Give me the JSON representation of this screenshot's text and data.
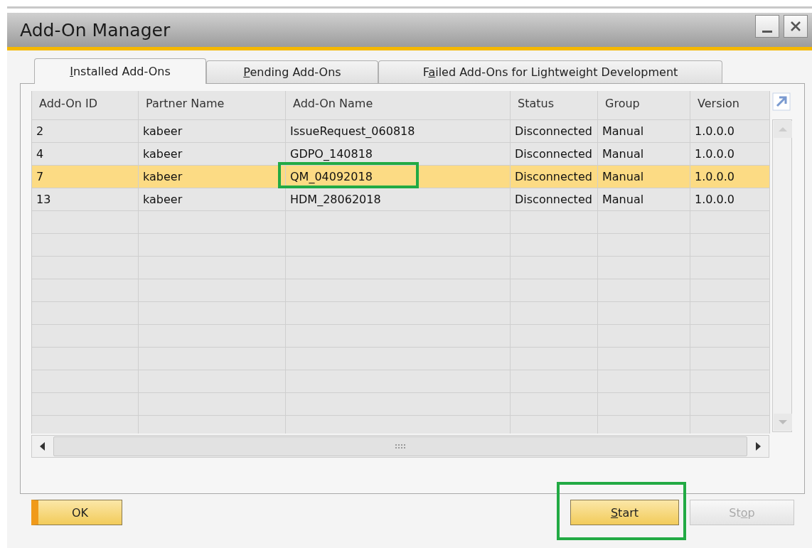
{
  "window": {
    "title": "Add-On Manager"
  },
  "tabs": [
    {
      "access_key": "I",
      "label_rest": "nstalled Add-Ons",
      "selected": true
    },
    {
      "access_key": "P",
      "label_rest": "ending Add-Ons",
      "selected": false
    },
    {
      "label_start": "F",
      "access_key": "a",
      "label_rest": "iled Add-Ons for Lightweight Development",
      "selected": false
    }
  ],
  "table": {
    "columns": [
      "Add-On ID",
      "Partner Name",
      "Add-On Name",
      "Status",
      "Group",
      "Version"
    ],
    "rows": [
      {
        "selected": false,
        "cells": [
          {
            "text": "2",
            "marked": false
          },
          {
            "text": "kabeer",
            "marked": false
          },
          {
            "text": "IssueRequest_060818",
            "marked": false
          },
          {
            "text": "Disconnected",
            "marked": false
          },
          {
            "text": "Manual",
            "marked": false
          },
          {
            "text": "1.0.0.0",
            "marked": false
          }
        ]
      },
      {
        "selected": false,
        "cells": [
          {
            "text": "4",
            "marked": false
          },
          {
            "text": "kabeer",
            "marked": false
          },
          {
            "text": "GDPO_140818",
            "marked": false
          },
          {
            "text": "Disconnected",
            "marked": false
          },
          {
            "text": "Manual",
            "marked": false
          },
          {
            "text": "1.0.0.0",
            "marked": false
          }
        ]
      },
      {
        "selected": true,
        "cells": [
          {
            "text": "7",
            "marked": false
          },
          {
            "text": "kabeer",
            "marked": false
          },
          {
            "text": "QM_04092018",
            "marked": true
          },
          {
            "text": "Disconnected",
            "marked": false
          },
          {
            "text": "Manual",
            "marked": false
          },
          {
            "text": "1.0.0.0",
            "marked": false
          }
        ]
      },
      {
        "selected": false,
        "cells": [
          {
            "text": "13",
            "marked": false
          },
          {
            "text": "kabeer",
            "marked": false
          },
          {
            "text": "HDM_28062018",
            "marked": false
          },
          {
            "text": "Disconnected",
            "marked": false
          },
          {
            "text": "Manual",
            "marked": false
          },
          {
            "text": "1.0.0.0",
            "marked": false
          }
        ]
      }
    ]
  },
  "buttons": [
    {
      "label_start": "OK",
      "disabled": false,
      "marked": false
    },
    {
      "access_key": "S",
      "label_rest": "tart",
      "disabled": false,
      "marked": true
    },
    {
      "label_start": "St",
      "access_key": "o",
      "label_rest": "p",
      "disabled": true,
      "marked": false
    }
  ]
}
